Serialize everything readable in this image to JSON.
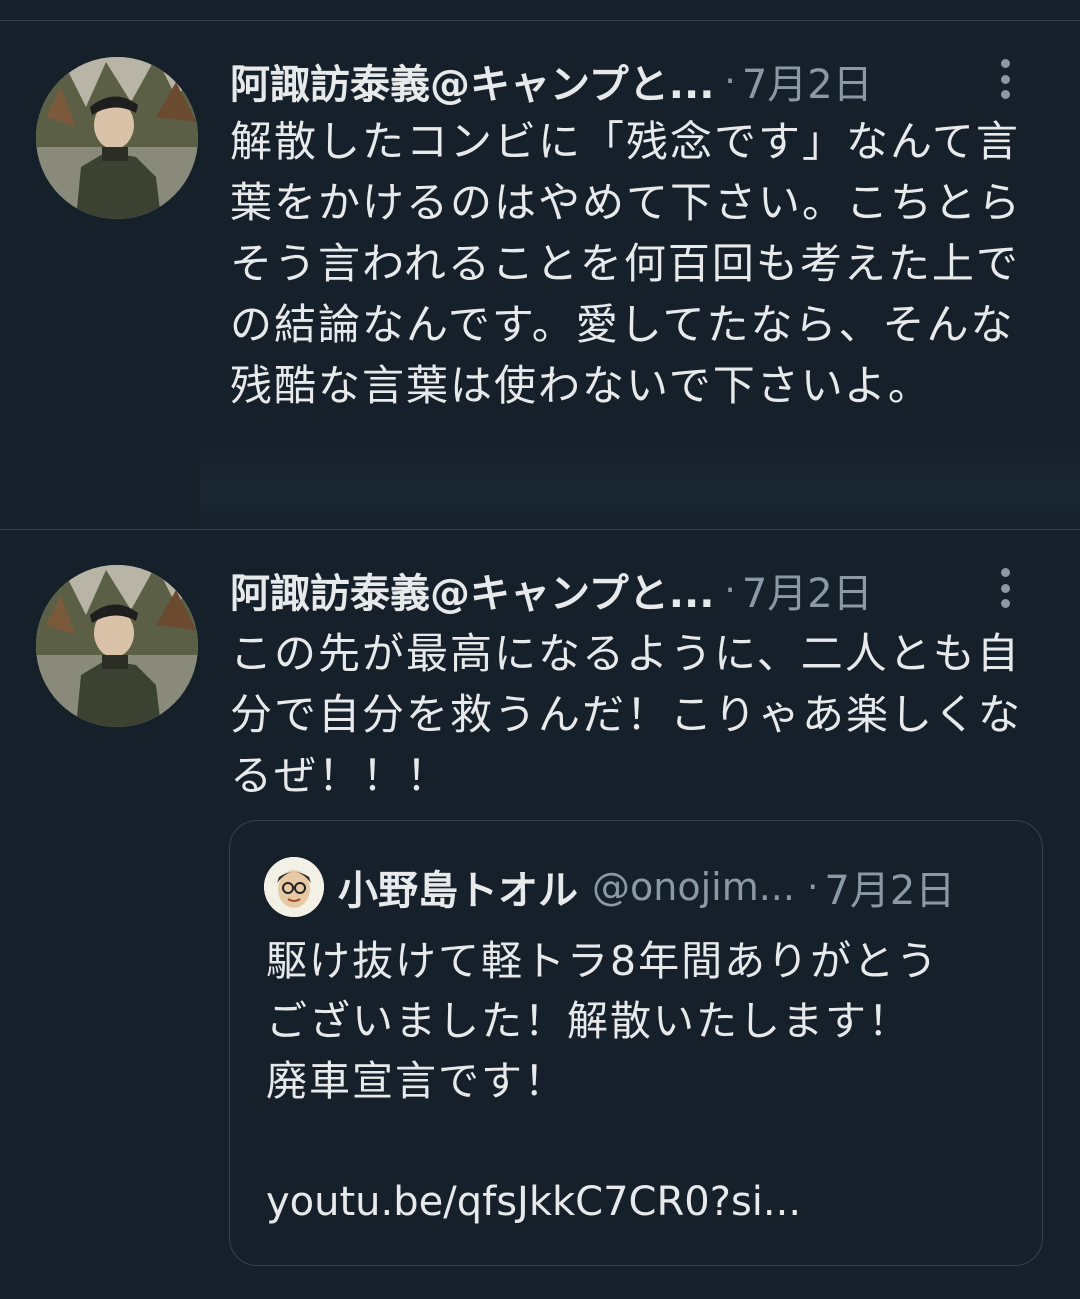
{
  "tweets": [
    {
      "author": "阿諏訪泰義@キャンプと...",
      "date": "7月2日",
      "text": "解散したコンビに「残念です」なんて言葉をかけるのはやめて下さい。こちとらそう言われることを何百回も考えた上での結論なんです。愛してたなら、そんな残酷な言葉は使わないで下さいよ。"
    },
    {
      "author": "阿諏訪泰義@キャンプと...",
      "date": "7月2日",
      "text": "この先が最高になるように、二人とも自分で自分を救うんだ！こりゃあ楽しくなるぜ！！！",
      "quote": {
        "author": "小野島トオル",
        "handle": "@onojim...",
        "date": "7月2日",
        "lines": [
          "駆け抜けて軽トラ8年間ありがとう",
          "ございました！解散いたします！",
          "廃車宣言です！"
        ],
        "link": "youtu.be/qfsJkkC7CR0?si..."
      }
    }
  ],
  "separator": "·",
  "icons": {
    "more": "more-vertical-icon",
    "avatar": "user-avatar"
  },
  "colors": {
    "background": "#15202b",
    "text": "#e7e9ea",
    "secondary": "#8b98a5",
    "border": "#38444d"
  }
}
